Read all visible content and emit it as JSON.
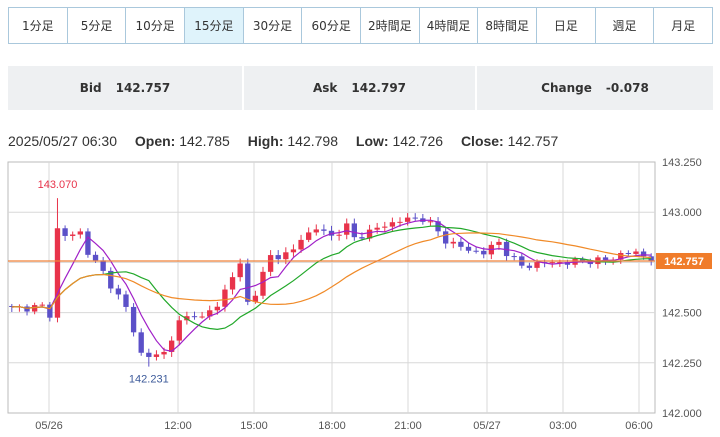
{
  "timeframes": [
    {
      "label": "1分足",
      "active": false
    },
    {
      "label": "5分足",
      "active": false
    },
    {
      "label": "10分足",
      "active": false
    },
    {
      "label": "15分足",
      "active": true
    },
    {
      "label": "30分足",
      "active": false
    },
    {
      "label": "60分足",
      "active": false
    },
    {
      "label": "2時間足",
      "active": false
    },
    {
      "label": "4時間足",
      "active": false
    },
    {
      "label": "8時間足",
      "active": false
    },
    {
      "label": "日足",
      "active": false
    },
    {
      "label": "週足",
      "active": false
    },
    {
      "label": "月足",
      "active": false
    }
  ],
  "quote": {
    "bid_label": "Bid",
    "bid_value": "142.757",
    "ask_label": "Ask",
    "ask_value": "142.797",
    "change_label": "Change",
    "change_value": "-0.078"
  },
  "ohlc": {
    "datetime": "2025/05/27 06:30",
    "open_label": "Open:",
    "open": "142.785",
    "high_label": "High:",
    "high": "142.798",
    "low_label": "Low:",
    "low": "142.726",
    "close_label": "Close:",
    "close": "142.757"
  },
  "colors": {
    "up": "#e8334a",
    "down": "#5b50c8",
    "ma_short": "#a020c8",
    "ma_mid": "#22a82a",
    "ma_long": "#f08a28",
    "price_line": "#f0823a",
    "price_tag": "#f07c2a"
  },
  "chart_data": {
    "type": "candlestick",
    "y_range": [
      142.0,
      143.25
    ],
    "y_ticks": [
      "143.250",
      "143.000",
      "142.750",
      "142.500",
      "142.250",
      "142.000"
    ],
    "x_tick_labels": [
      "05/26",
      "12:00",
      "15:00",
      "18:00",
      "21:00",
      "05/27",
      "03:00",
      "06:00"
    ],
    "grid": true,
    "current_price": "142.757",
    "current_price_value": 142.757,
    "high_annotation": "143.070",
    "low_annotation": "142.231",
    "price_waypoints": [
      [
        0,
        142.52
      ],
      [
        4,
        142.53
      ],
      [
        5,
        142.49
      ],
      [
        6,
        142.95
      ],
      [
        7,
        142.88
      ],
      [
        9,
        142.9
      ],
      [
        10,
        142.8
      ],
      [
        12,
        142.7
      ],
      [
        14,
        142.58
      ],
      [
        15,
        142.52
      ],
      [
        17,
        142.31
      ],
      [
        18,
        142.28
      ],
      [
        20,
        142.3
      ],
      [
        22,
        142.45
      ],
      [
        24,
        142.5
      ],
      [
        25,
        142.47
      ],
      [
        27,
        142.54
      ],
      [
        29,
        142.68
      ],
      [
        30,
        142.74
      ],
      [
        31,
        142.55
      ],
      [
        32,
        142.6
      ],
      [
        34,
        142.78
      ],
      [
        36,
        142.79
      ],
      [
        37,
        142.81
      ],
      [
        38,
        142.87
      ],
      [
        40,
        142.92
      ],
      [
        42,
        142.88
      ],
      [
        44,
        142.93
      ],
      [
        45,
        142.87
      ],
      [
        48,
        142.92
      ],
      [
        51,
        142.96
      ],
      [
        54,
        142.97
      ],
      [
        55,
        142.94
      ],
      [
        57,
        142.86
      ],
      [
        60,
        142.81
      ],
      [
        62,
        142.8
      ],
      [
        64,
        142.85
      ],
      [
        65,
        142.8
      ],
      [
        67,
        142.73
      ],
      [
        70,
        142.75
      ],
      [
        73,
        142.75
      ],
      [
        76,
        142.76
      ],
      [
        78,
        142.76
      ],
      [
        80,
        142.79
      ],
      [
        82,
        142.8
      ],
      [
        83,
        142.78
      ],
      [
        84,
        142.757
      ]
    ]
  }
}
